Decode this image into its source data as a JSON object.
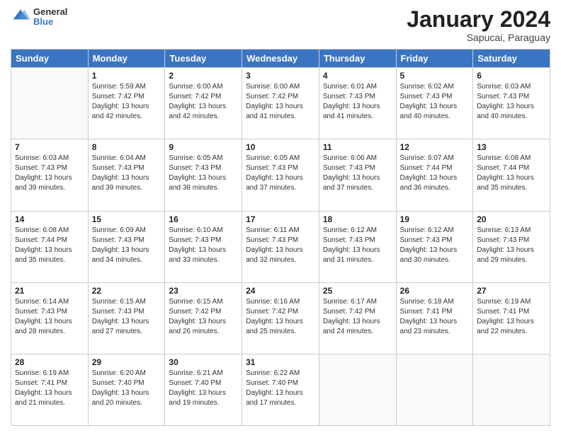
{
  "header": {
    "logo_line1": "General",
    "logo_line2": "Blue",
    "title": "January 2024",
    "subtitle": "Sapucai, Paraguay"
  },
  "weekdays": [
    "Sunday",
    "Monday",
    "Tuesday",
    "Wednesday",
    "Thursday",
    "Friday",
    "Saturday"
  ],
  "weeks": [
    [
      {
        "day": "",
        "sunrise": "",
        "sunset": "",
        "daylight": ""
      },
      {
        "day": "1",
        "sunrise": "Sunrise: 5:59 AM",
        "sunset": "Sunset: 7:42 PM",
        "daylight": "Daylight: 13 hours and 42 minutes."
      },
      {
        "day": "2",
        "sunrise": "Sunrise: 6:00 AM",
        "sunset": "Sunset: 7:42 PM",
        "daylight": "Daylight: 13 hours and 42 minutes."
      },
      {
        "day": "3",
        "sunrise": "Sunrise: 6:00 AM",
        "sunset": "Sunset: 7:42 PM",
        "daylight": "Daylight: 13 hours and 41 minutes."
      },
      {
        "day": "4",
        "sunrise": "Sunrise: 6:01 AM",
        "sunset": "Sunset: 7:43 PM",
        "daylight": "Daylight: 13 hours and 41 minutes."
      },
      {
        "day": "5",
        "sunrise": "Sunrise: 6:02 AM",
        "sunset": "Sunset: 7:43 PM",
        "daylight": "Daylight: 13 hours and 40 minutes."
      },
      {
        "day": "6",
        "sunrise": "Sunrise: 6:03 AM",
        "sunset": "Sunset: 7:43 PM",
        "daylight": "Daylight: 13 hours and 40 minutes."
      }
    ],
    [
      {
        "day": "7",
        "sunrise": "Sunrise: 6:03 AM",
        "sunset": "Sunset: 7:43 PM",
        "daylight": "Daylight: 13 hours and 39 minutes."
      },
      {
        "day": "8",
        "sunrise": "Sunrise: 6:04 AM",
        "sunset": "Sunset: 7:43 PM",
        "daylight": "Daylight: 13 hours and 39 minutes."
      },
      {
        "day": "9",
        "sunrise": "Sunrise: 6:05 AM",
        "sunset": "Sunset: 7:43 PM",
        "daylight": "Daylight: 13 hours and 38 minutes."
      },
      {
        "day": "10",
        "sunrise": "Sunrise: 6:05 AM",
        "sunset": "Sunset: 7:43 PM",
        "daylight": "Daylight: 13 hours and 37 minutes."
      },
      {
        "day": "11",
        "sunrise": "Sunrise: 6:06 AM",
        "sunset": "Sunset: 7:43 PM",
        "daylight": "Daylight: 13 hours and 37 minutes."
      },
      {
        "day": "12",
        "sunrise": "Sunrise: 6:07 AM",
        "sunset": "Sunset: 7:44 PM",
        "daylight": "Daylight: 13 hours and 36 minutes."
      },
      {
        "day": "13",
        "sunrise": "Sunrise: 6:08 AM",
        "sunset": "Sunset: 7:44 PM",
        "daylight": "Daylight: 13 hours and 35 minutes."
      }
    ],
    [
      {
        "day": "14",
        "sunrise": "Sunrise: 6:08 AM",
        "sunset": "Sunset: 7:44 PM",
        "daylight": "Daylight: 13 hours and 35 minutes."
      },
      {
        "day": "15",
        "sunrise": "Sunrise: 6:09 AM",
        "sunset": "Sunset: 7:43 PM",
        "daylight": "Daylight: 13 hours and 34 minutes."
      },
      {
        "day": "16",
        "sunrise": "Sunrise: 6:10 AM",
        "sunset": "Sunset: 7:43 PM",
        "daylight": "Daylight: 13 hours and 33 minutes."
      },
      {
        "day": "17",
        "sunrise": "Sunrise: 6:11 AM",
        "sunset": "Sunset: 7:43 PM",
        "daylight": "Daylight: 13 hours and 32 minutes."
      },
      {
        "day": "18",
        "sunrise": "Sunrise: 6:12 AM",
        "sunset": "Sunset: 7:43 PM",
        "daylight": "Daylight: 13 hours and 31 minutes."
      },
      {
        "day": "19",
        "sunrise": "Sunrise: 6:12 AM",
        "sunset": "Sunset: 7:43 PM",
        "daylight": "Daylight: 13 hours and 30 minutes."
      },
      {
        "day": "20",
        "sunrise": "Sunrise: 6:13 AM",
        "sunset": "Sunset: 7:43 PM",
        "daylight": "Daylight: 13 hours and 29 minutes."
      }
    ],
    [
      {
        "day": "21",
        "sunrise": "Sunrise: 6:14 AM",
        "sunset": "Sunset: 7:43 PM",
        "daylight": "Daylight: 13 hours and 28 minutes."
      },
      {
        "day": "22",
        "sunrise": "Sunrise: 6:15 AM",
        "sunset": "Sunset: 7:43 PM",
        "daylight": "Daylight: 13 hours and 27 minutes."
      },
      {
        "day": "23",
        "sunrise": "Sunrise: 6:15 AM",
        "sunset": "Sunset: 7:42 PM",
        "daylight": "Daylight: 13 hours and 26 minutes."
      },
      {
        "day": "24",
        "sunrise": "Sunrise: 6:16 AM",
        "sunset": "Sunset: 7:42 PM",
        "daylight": "Daylight: 13 hours and 25 minutes."
      },
      {
        "day": "25",
        "sunrise": "Sunrise: 6:17 AM",
        "sunset": "Sunset: 7:42 PM",
        "daylight": "Daylight: 13 hours and 24 minutes."
      },
      {
        "day": "26",
        "sunrise": "Sunrise: 6:18 AM",
        "sunset": "Sunset: 7:41 PM",
        "daylight": "Daylight: 13 hours and 23 minutes."
      },
      {
        "day": "27",
        "sunrise": "Sunrise: 6:19 AM",
        "sunset": "Sunset: 7:41 PM",
        "daylight": "Daylight: 13 hours and 22 minutes."
      }
    ],
    [
      {
        "day": "28",
        "sunrise": "Sunrise: 6:19 AM",
        "sunset": "Sunset: 7:41 PM",
        "daylight": "Daylight: 13 hours and 21 minutes."
      },
      {
        "day": "29",
        "sunrise": "Sunrise: 6:20 AM",
        "sunset": "Sunset: 7:40 PM",
        "daylight": "Daylight: 13 hours and 20 minutes."
      },
      {
        "day": "30",
        "sunrise": "Sunrise: 6:21 AM",
        "sunset": "Sunset: 7:40 PM",
        "daylight": "Daylight: 13 hours and 19 minutes."
      },
      {
        "day": "31",
        "sunrise": "Sunrise: 6:22 AM",
        "sunset": "Sunset: 7:40 PM",
        "daylight": "Daylight: 13 hours and 17 minutes."
      },
      {
        "day": "",
        "sunrise": "",
        "sunset": "",
        "daylight": ""
      },
      {
        "day": "",
        "sunrise": "",
        "sunset": "",
        "daylight": ""
      },
      {
        "day": "",
        "sunrise": "",
        "sunset": "",
        "daylight": ""
      }
    ]
  ]
}
